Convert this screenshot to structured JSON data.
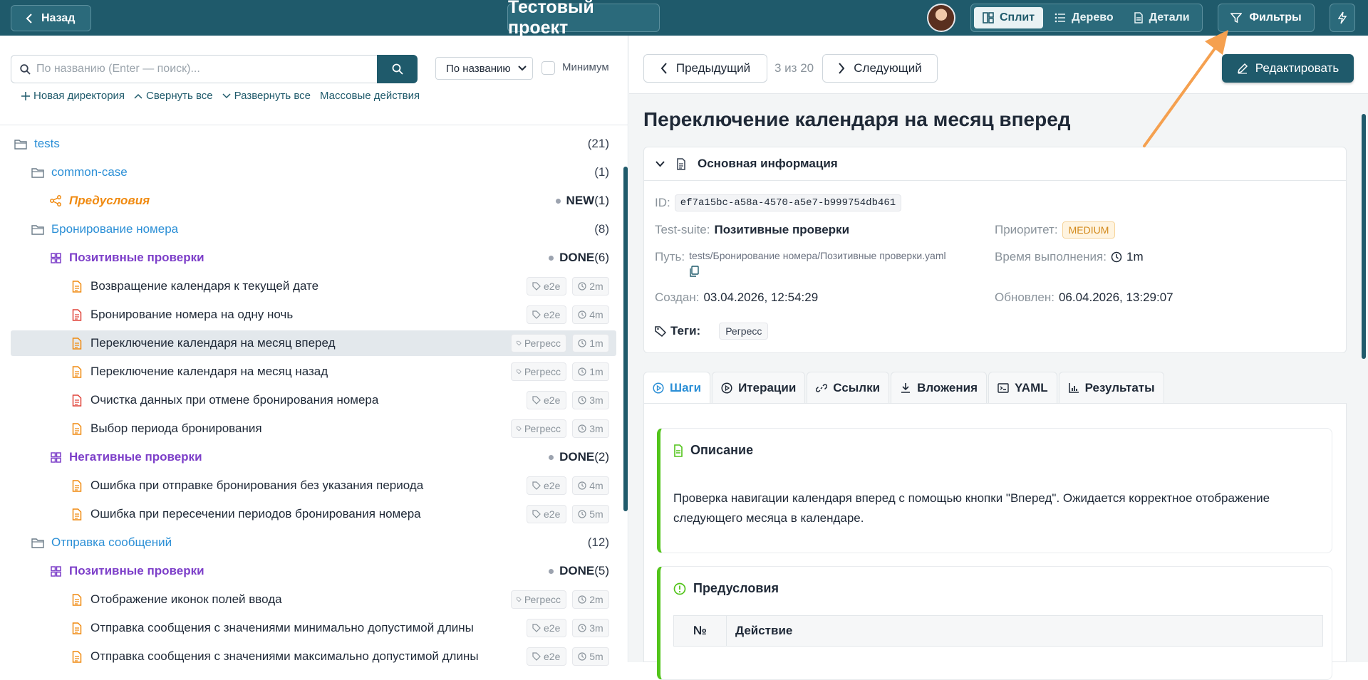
{
  "header": {
    "back_label": "Назад",
    "project_title": "Тестовый проект",
    "views": [
      {
        "label": "Сплит",
        "icon": "split-icon",
        "active": true
      },
      {
        "label": "Дерево",
        "icon": "list-icon",
        "active": false
      },
      {
        "label": "Детали",
        "icon": "document-icon",
        "active": false
      }
    ],
    "filters_label": "Фильтры"
  },
  "left": {
    "search_placeholder": "По названию (Enter — поиск)...",
    "sort_value": "По названию",
    "minimum_label": "Минимум",
    "toolbar": {
      "new_dir": "Новая директория",
      "collapse_all": "Свернуть все",
      "expand_all": "Развернуть все",
      "bulk_actions": "Массовые действия"
    },
    "tree": [
      {
        "type": "folder",
        "name": "tests",
        "count": "(21)",
        "level": 0
      },
      {
        "type": "folder",
        "name": "common-case",
        "count": "(1)",
        "level": 1
      },
      {
        "type": "pre",
        "name": "Предусловия",
        "status": "NEW",
        "cnt": "(1)",
        "level": 2
      },
      {
        "type": "folder",
        "name": "Бронирование номера",
        "count": "(8)",
        "level": 1
      },
      {
        "type": "suite",
        "name": "Позитивные проверки",
        "status": "DONE",
        "cnt": "(6)",
        "level": 2
      },
      {
        "type": "case",
        "name": "Возвращение календаря к текущей дате",
        "tag": "e2e",
        "dur": "2m",
        "level": 3,
        "color": "#f08a10"
      },
      {
        "type": "case",
        "name": "Бронирование номера на одну ночь",
        "tag": "e2e",
        "dur": "4m",
        "level": 3,
        "color": "#e0443a"
      },
      {
        "type": "case",
        "name": "Переключение календаря на месяц вперед",
        "tag": "Регресс",
        "dur": "1m",
        "level": 3,
        "color": "#f08a10",
        "selected": true
      },
      {
        "type": "case",
        "name": "Переключение календаря на месяц назад",
        "tag": "Регресс",
        "dur": "1m",
        "level": 3,
        "color": "#f08a10"
      },
      {
        "type": "case",
        "name": "Очистка данных при отмене бронирования номера",
        "tag": "e2e",
        "dur": "3m",
        "level": 3,
        "color": "#e0443a"
      },
      {
        "type": "case",
        "name": "Выбор периода бронирования",
        "tag": "Регресс",
        "dur": "3m",
        "level": 3,
        "color": "#f08a10"
      },
      {
        "type": "suite",
        "name": "Негативные проверки",
        "status": "DONE",
        "cnt": "(2)",
        "level": 2
      },
      {
        "type": "case",
        "name": "Ошибка при отправке бронирования без указания периода",
        "tag": "e2e",
        "dur": "4m",
        "level": 3,
        "color": "#f08a10"
      },
      {
        "type": "case",
        "name": "Ошибка при пересечении периодов бронирования номера",
        "tag": "e2e",
        "dur": "5m",
        "level": 3,
        "color": "#f08a10"
      },
      {
        "type": "folder",
        "name": "Отправка сообщений",
        "count": "(12)",
        "level": 1
      },
      {
        "type": "suite",
        "name": "Позитивные проверки",
        "status": "DONE",
        "cnt": "(5)",
        "level": 2
      },
      {
        "type": "case",
        "name": "Отображение иконок полей ввода",
        "tag": "Регресс",
        "dur": "2m",
        "level": 3,
        "color": "#f08a10"
      },
      {
        "type": "case",
        "name": "Отправка сообщения с значениями минимально допустимой длины",
        "tag": "e2e",
        "dur": "3m",
        "level": 3,
        "color": "#f08a10"
      },
      {
        "type": "case",
        "name": "Отправка сообщения с значениями максимально допустимой длины",
        "tag": "e2e",
        "dur": "5m",
        "level": 3,
        "color": "#f08a10"
      }
    ]
  },
  "right": {
    "prev_label": "Предыдущий",
    "position": "3 из 20",
    "next_label": "Следующий",
    "edit_label": "Редактировать",
    "title": "Переключение календаря на месяц вперед",
    "info_header": "Основная информация",
    "id_label": "ID:",
    "id_value": "ef7a15bc-a58a-4570-a5e7-b999754db461",
    "suite_label": "Test-suite:",
    "suite_value": "Позитивные проверки",
    "priority_label": "Приоритет:",
    "priority_value": "MEDIUM",
    "path_label": "Путь:",
    "path_value": "tests/Бронирование номера/Позитивные проверки.yaml",
    "duration_label": "Время выполнения:",
    "duration_value": "1m",
    "created_label": "Создан:",
    "created_value": "03.04.2026, 12:54:29",
    "updated_label": "Обновлен:",
    "updated_value": "06.04.2026, 13:29:07",
    "tags_label": "Теги:",
    "tag_value": "Регресс",
    "tabs": [
      {
        "label": "Шаги",
        "icon": "play-circle-icon",
        "active": true
      },
      {
        "label": "Итерации",
        "icon": "play-circle-icon",
        "active": false
      },
      {
        "label": "Ссылки",
        "icon": "link-icon",
        "active": false
      },
      {
        "label": "Вложения",
        "icon": "download-icon",
        "active": false
      },
      {
        "label": "YAML",
        "icon": "terminal-icon",
        "active": false
      },
      {
        "label": "Результаты",
        "icon": "bar-chart-icon",
        "active": false
      }
    ],
    "description_title": "Описание",
    "description_text": "Проверка навигации календаря вперед с помощью кнопки \"Вперед\". Ожидается корректное отображение следующего месяца в календаре.",
    "preconditions_title": "Предусловия",
    "table_col_num": "№",
    "table_col_action": "Действие"
  },
  "colors": {
    "topbar": "#1f5a6b",
    "accent_blue": "#2b8fd6",
    "suite_purple": "#7d3fc9",
    "pre_orange": "#f08a10",
    "success_green": "#52c41a",
    "annotation_arrow": "#f5a04f"
  }
}
